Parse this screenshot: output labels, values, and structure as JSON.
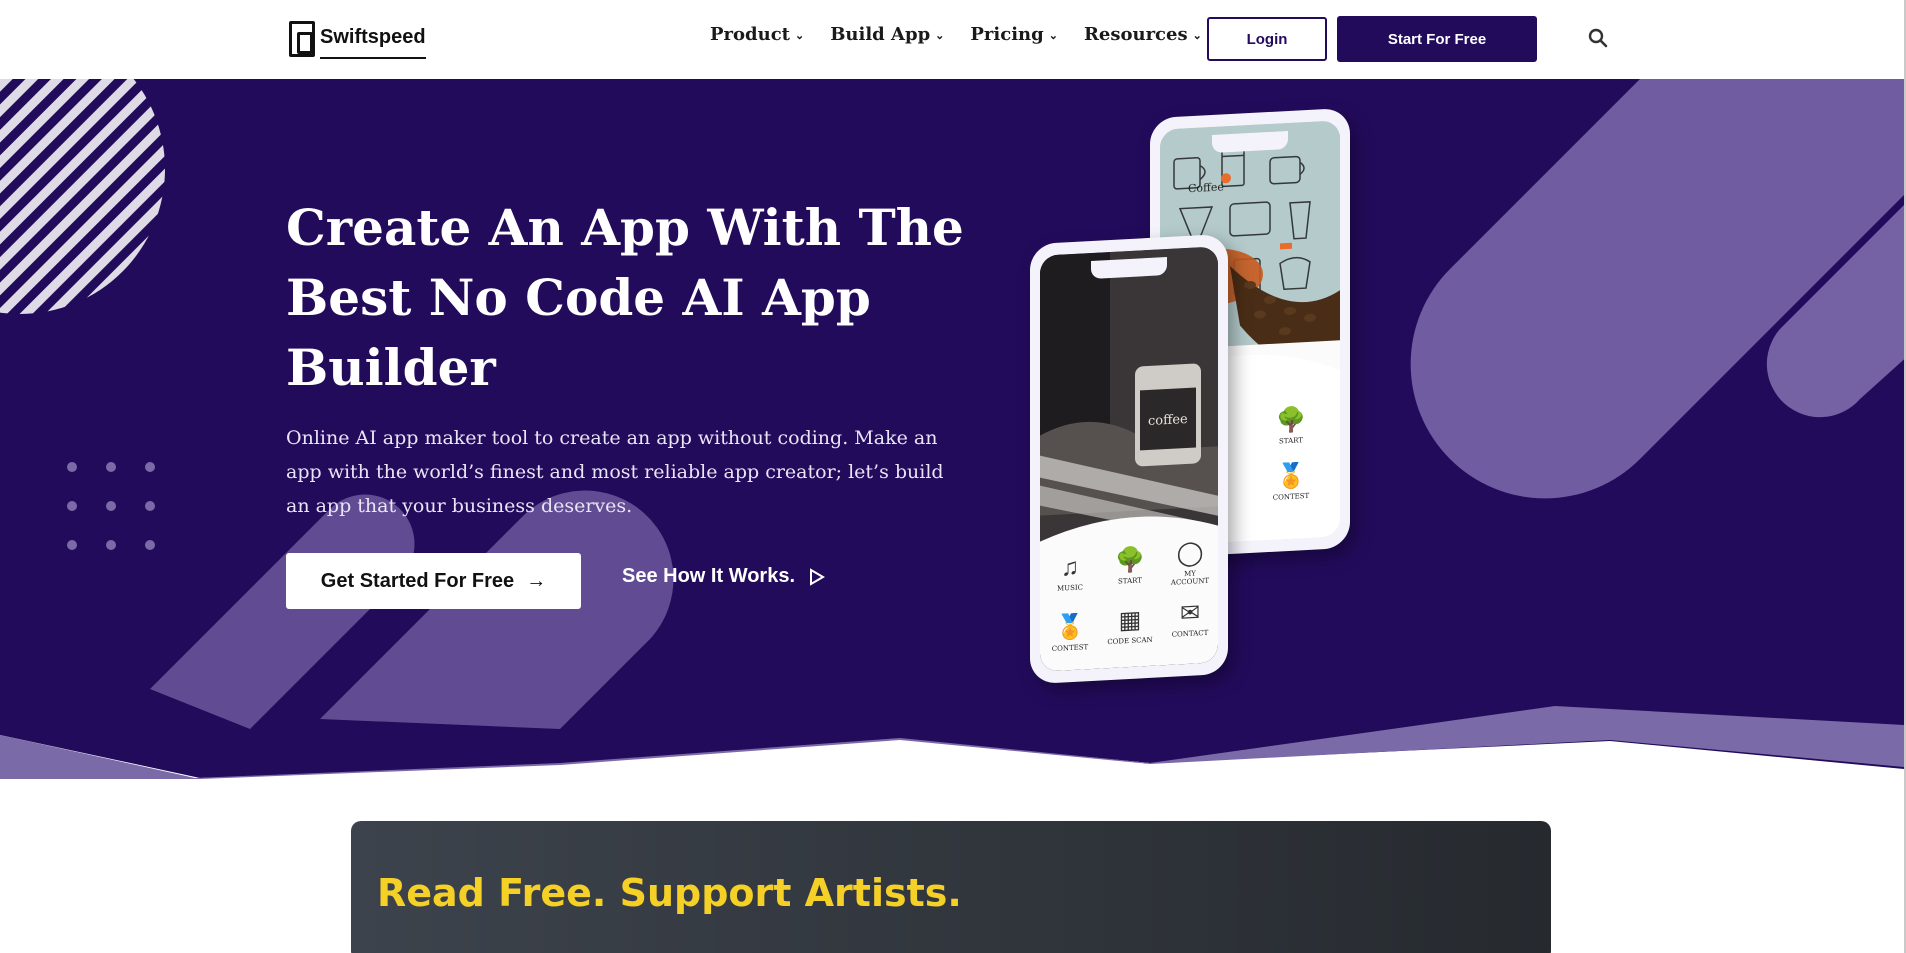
{
  "brand": {
    "name": "Swiftspeed"
  },
  "nav": {
    "items": [
      {
        "label": "Product"
      },
      {
        "label": "Build App"
      },
      {
        "label": "Pricing"
      },
      {
        "label": "Resources"
      }
    ],
    "login_label": "Login",
    "start_label": "Start For Free",
    "search_icon": "search-icon"
  },
  "hero": {
    "title": "Create An App With The Best No Code AI App Builder",
    "subtitle": "Online AI app maker tool to create an app without coding. Make an app with the world’s finest and most reliable app creator; let’s build an app that your business deserves.",
    "cta_label": "Get Started For Free",
    "video_link_label": "See How It Works."
  },
  "phone_back": {
    "screen_text": "Coffee",
    "apps": [
      {
        "label": "START",
        "icon": "tree-icon"
      },
      {
        "label": "CONTEST",
        "icon": "medal-icon"
      }
    ]
  },
  "phone_front": {
    "screen_text": "coffee",
    "apps": [
      {
        "label": "MUSIC",
        "icon": "music-icon"
      },
      {
        "label": "START",
        "icon": "tree-icon"
      },
      {
        "label": "MY ACCOUNT",
        "icon": "account-icon"
      },
      {
        "label": "CONTEST",
        "icon": "medal-icon"
      },
      {
        "label": "CODE SCAN",
        "icon": "scan-icon"
      },
      {
        "label": "CONTACT",
        "icon": "mail-icon"
      }
    ]
  },
  "banner": {
    "title": "Read Free. Support Artists."
  },
  "colors": {
    "brand": "#230b5c",
    "accent_yellow": "#f5d027",
    "decor": "#7b6aa8"
  }
}
